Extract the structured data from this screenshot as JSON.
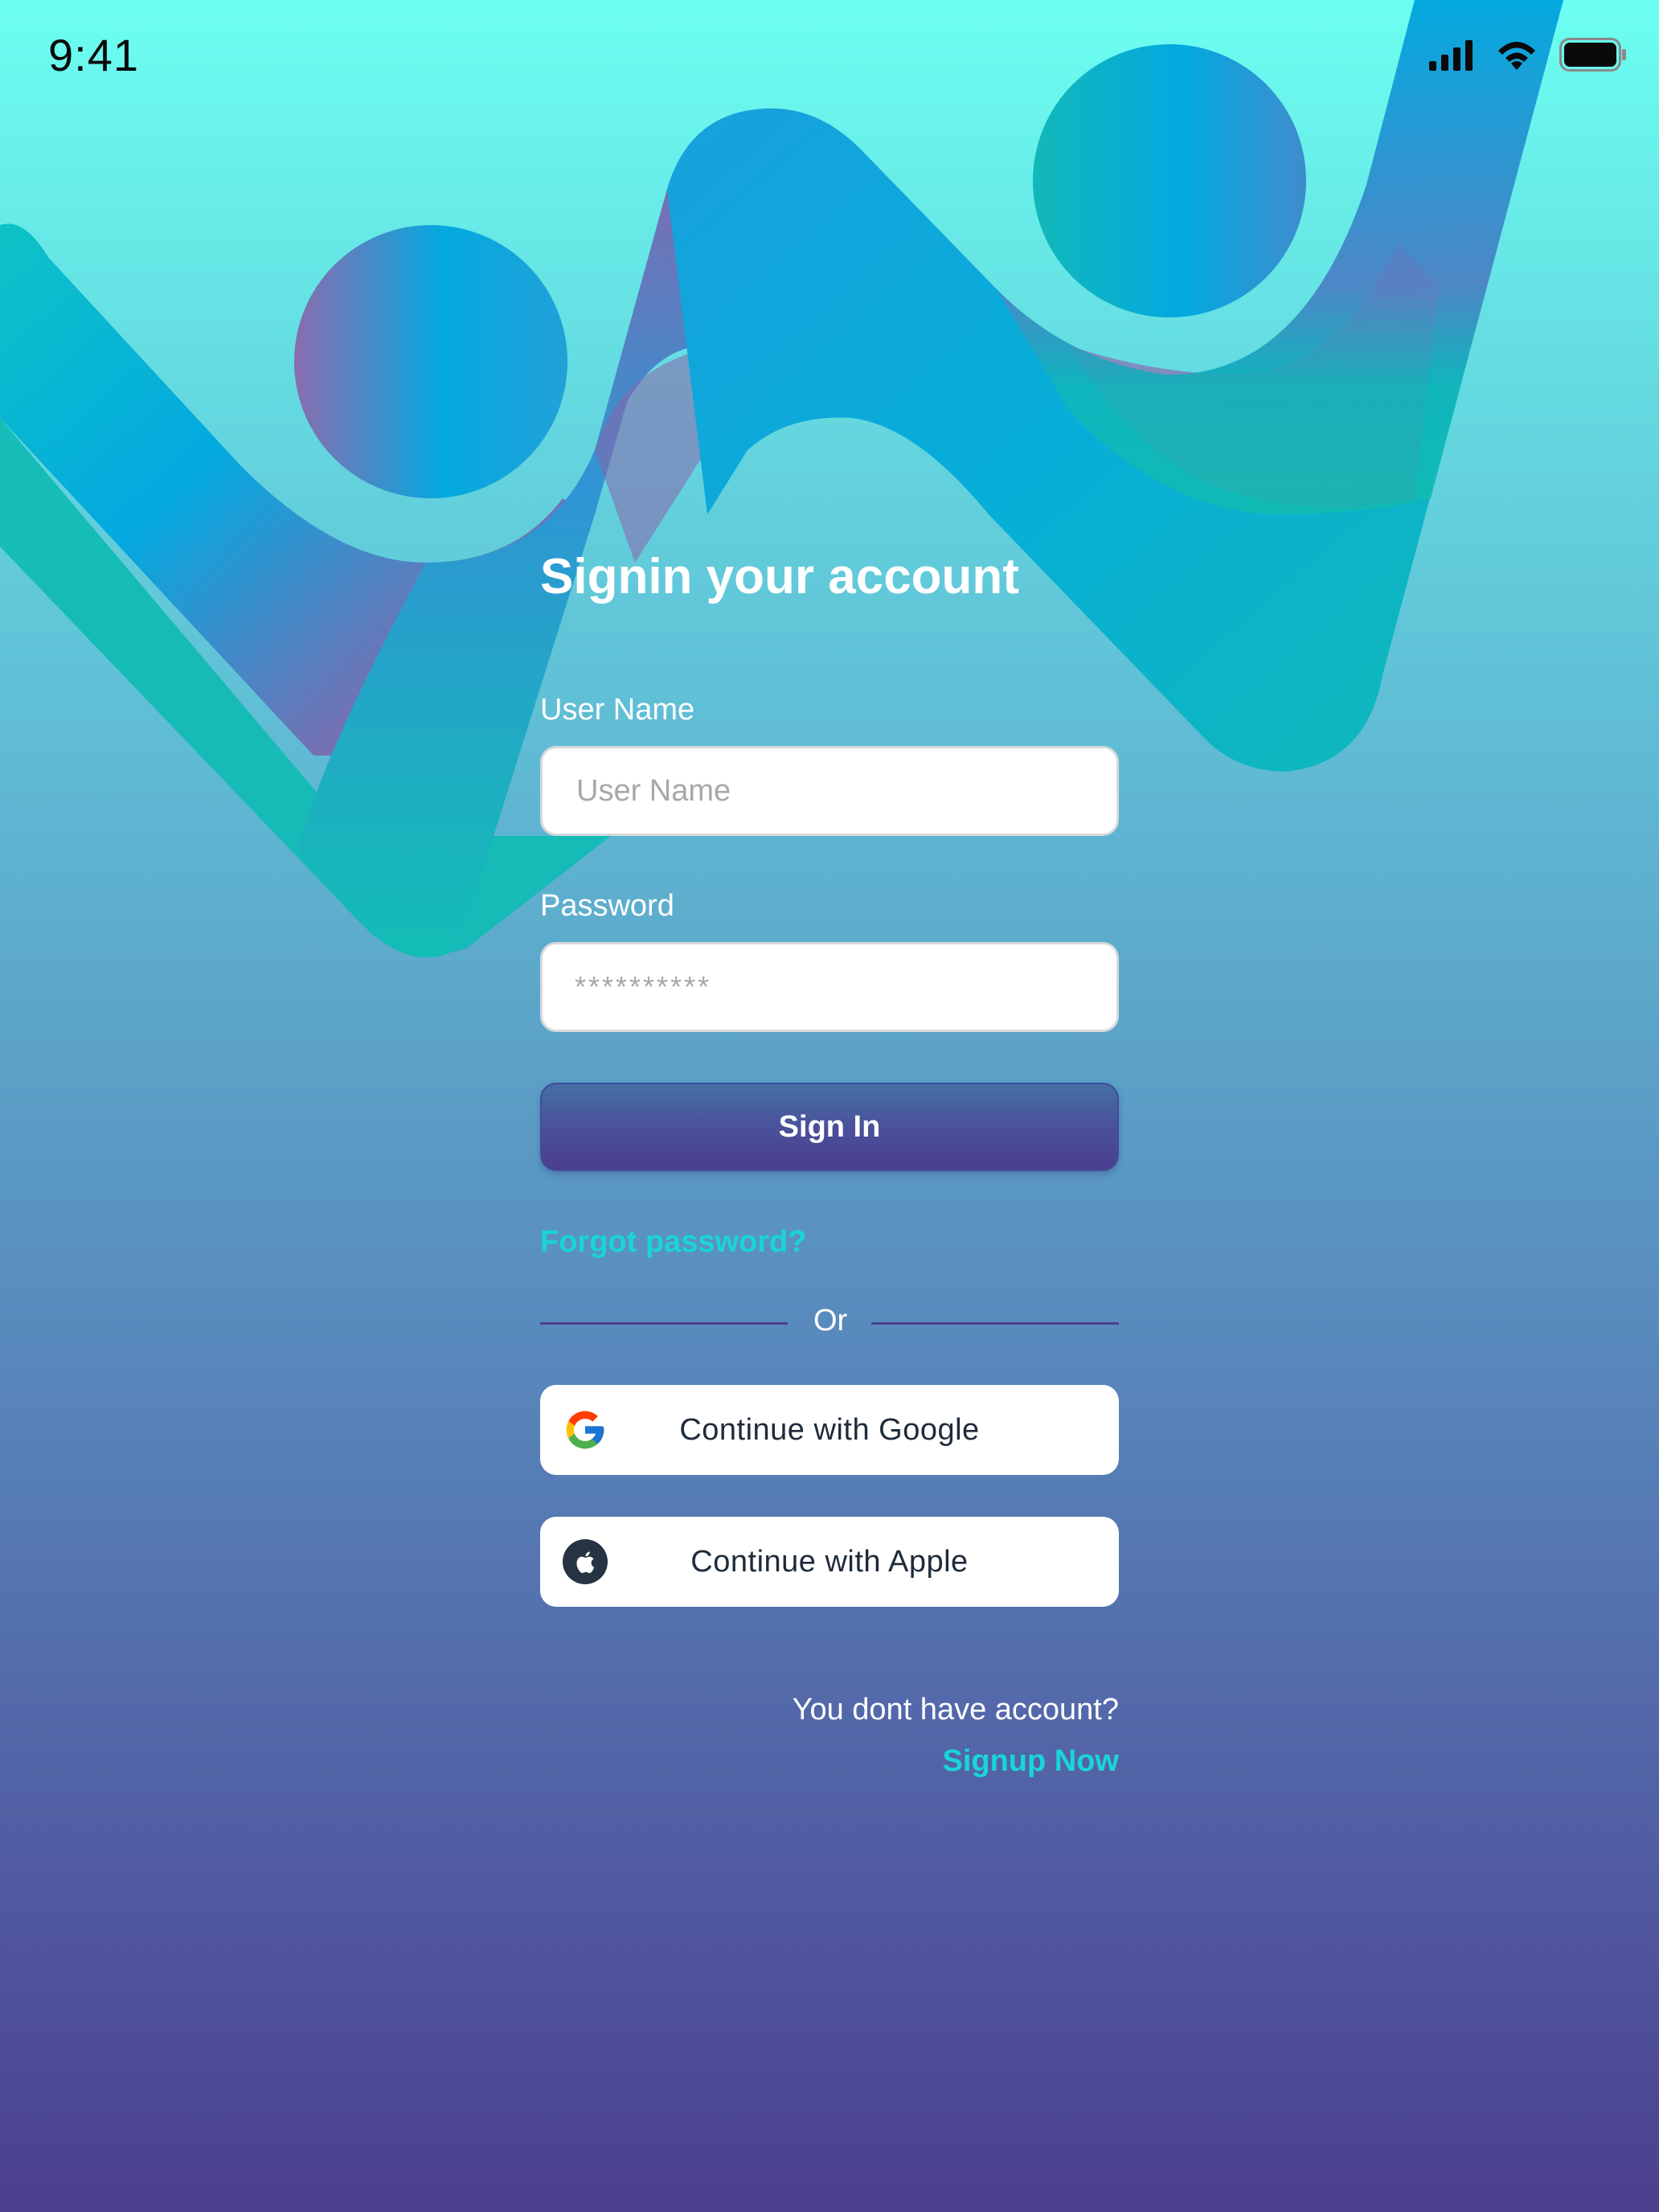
{
  "status_bar": {
    "time": "9:41"
  },
  "form": {
    "title": "Signin your account",
    "username": {
      "label": "User Name",
      "placeholder": "User Name"
    },
    "password": {
      "label": "Password",
      "mask": "**********"
    },
    "signin_label": "Sign In",
    "forgot_label": "Forgot password?",
    "divider_label": "Or"
  },
  "social": {
    "google_label": "Continue with Google",
    "apple_label": "Continue with Apple",
    "google_icon": "google-g-icon",
    "apple_icon": "apple-logo-icon"
  },
  "footer": {
    "question": "You dont have account?",
    "signup_label": "Signup Now"
  },
  "colors": {
    "accent": "#19d5d8",
    "button": "#4a3f8f",
    "bg_top": "#6cfff1",
    "bg_bottom": "#4b3f8f"
  }
}
